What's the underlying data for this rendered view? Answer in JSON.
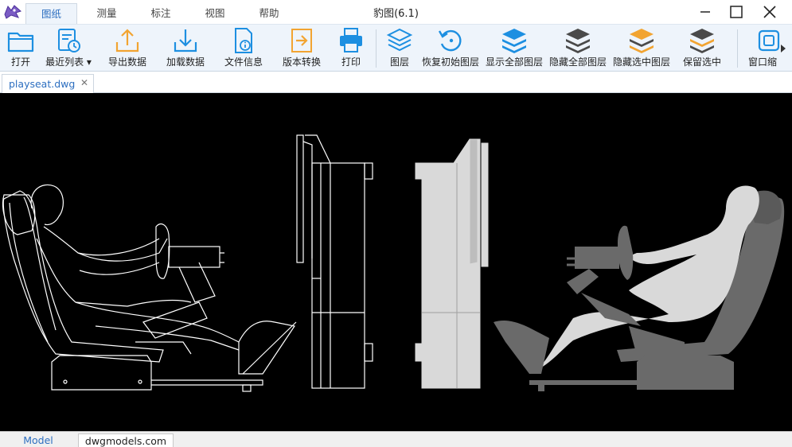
{
  "window": {
    "title": "豹图(6.1)",
    "minimize_glyph": "—",
    "maximize_glyph": "☐",
    "close_glyph": "✕"
  },
  "menu_tabs": [
    {
      "label": "图纸",
      "active": true
    },
    {
      "label": "测量",
      "active": false
    },
    {
      "label": "标注",
      "active": false
    },
    {
      "label": "视图",
      "active": false
    },
    {
      "label": "帮助",
      "active": false
    }
  ],
  "ribbon": {
    "open": {
      "label": "打开",
      "icon": "folder-icon"
    },
    "recent": {
      "label": "最近列表 ▾",
      "icon": "recent-files-icon"
    },
    "export": {
      "label": "导出数据",
      "icon": "export-upload-icon"
    },
    "import": {
      "label": "加载数据",
      "icon": "import-download-icon"
    },
    "fileinfo": {
      "label": "文件信息",
      "icon": "file-info-icon"
    },
    "convert": {
      "label": "版本转换",
      "icon": "version-convert-icon"
    },
    "print": {
      "label": "打印",
      "icon": "printer-icon"
    },
    "layers": {
      "label": "图层",
      "icon": "layers-icon"
    },
    "restore": {
      "label": "恢复初始图层",
      "icon": "restore-layers-icon"
    },
    "show_all": {
      "label": "显示全部图层",
      "icon": "show-all-layers-icon"
    },
    "hide_all": {
      "label": "隐藏全部图层",
      "icon": "hide-all-layers-icon"
    },
    "hide_sel": {
      "label": "隐藏选中图层",
      "icon": "hide-selected-layers-icon"
    },
    "keep_sel": {
      "label": "保留选中",
      "icon": "keep-selected-layers-icon"
    },
    "window_zoom": {
      "label": "窗口缩",
      "icon": "window-zoom-icon"
    }
  },
  "document": {
    "tab_label": "playseat.dwg",
    "close_glyph": "✕"
  },
  "layout_tabs": [
    {
      "label": "Model",
      "active": true
    },
    {
      "label": "dwgmodels.com",
      "active": false
    }
  ],
  "colors": {
    "accent_blue": "#1d8fe1",
    "accent_orange": "#f2a431",
    "dark_gray": "#4a4a4a",
    "canvas_bg": "#000000",
    "drawing_white": "#ffffff",
    "drawing_light": "#d9d9d9",
    "drawing_dark": "#6a6a6a"
  }
}
